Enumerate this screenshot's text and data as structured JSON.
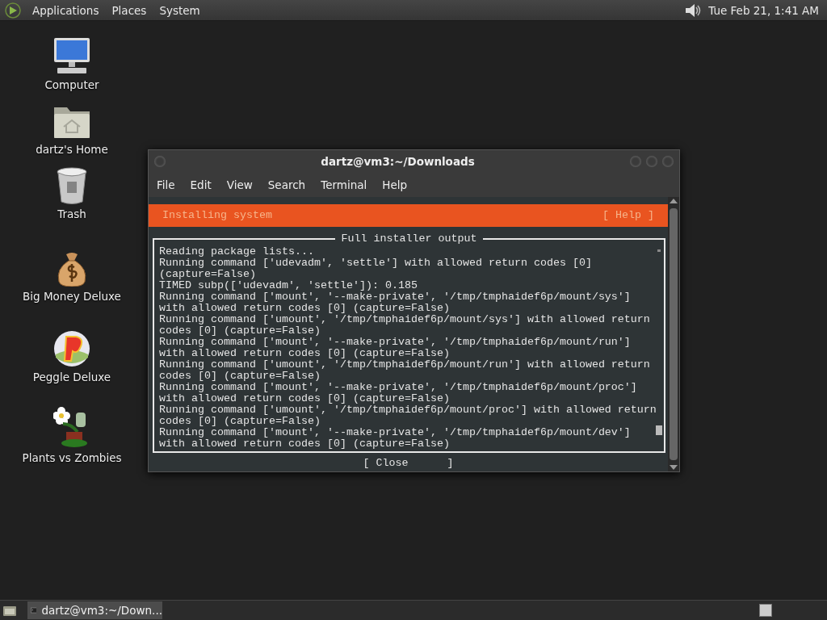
{
  "top_panel": {
    "menus": [
      "Applications",
      "Places",
      "System"
    ],
    "clock": "Tue Feb 21,  1:41 AM"
  },
  "desktop_icons": [
    {
      "label": "Computer",
      "kind": "computer"
    },
    {
      "label": "dartz's Home",
      "kind": "home"
    },
    {
      "label": "Trash",
      "kind": "trash"
    },
    {
      "label": "Big Money Deluxe",
      "kind": "moneybag"
    },
    {
      "label": "Peggle Deluxe",
      "kind": "peggle"
    },
    {
      "label": "Plants vs Zombies",
      "kind": "plants"
    }
  ],
  "window": {
    "title": "dartz@vm3:~/Downloads",
    "menu": [
      "File",
      "Edit",
      "View",
      "Search",
      "Terminal",
      "Help"
    ],
    "installer": {
      "header": "Installing system",
      "help": "[ Help ]",
      "box_title": "Full installer output",
      "lines": [
        "Reading package lists...",
        "Running command ['udevadm', 'settle'] with allowed return codes [0]",
        "(capture=False)",
        "TIMED subp(['udevadm', 'settle']): 0.185",
        "Running command ['mount', '--make-private', '/tmp/tmphaidef6p/mount/sys']",
        "with allowed return codes [0] (capture=False)",
        "Running command ['umount', '/tmp/tmphaidef6p/mount/sys'] with allowed return",
        "codes [0] (capture=False)",
        "Running command ['mount', '--make-private', '/tmp/tmphaidef6p/mount/run']",
        "with allowed return codes [0] (capture=False)",
        "Running command ['umount', '/tmp/tmphaidef6p/mount/run'] with allowed return",
        "codes [0] (capture=False)",
        "Running command ['mount', '--make-private', '/tmp/tmphaidef6p/mount/proc']",
        "with allowed return codes [0] (capture=False)",
        "Running command ['umount', '/tmp/tmphaidef6p/mount/proc'] with allowed return",
        "codes [0] (capture=False)",
        "Running command ['mount', '--make-private', '/tmp/tmphaidef6p/mount/dev']",
        "with allowed return codes [0] (capture=False)"
      ],
      "close": "[ Close      ]"
    }
  },
  "taskbar": {
    "tasks": [
      {
        "label": "dartz@vm3:~/Down...",
        "selected": true
      }
    ]
  }
}
